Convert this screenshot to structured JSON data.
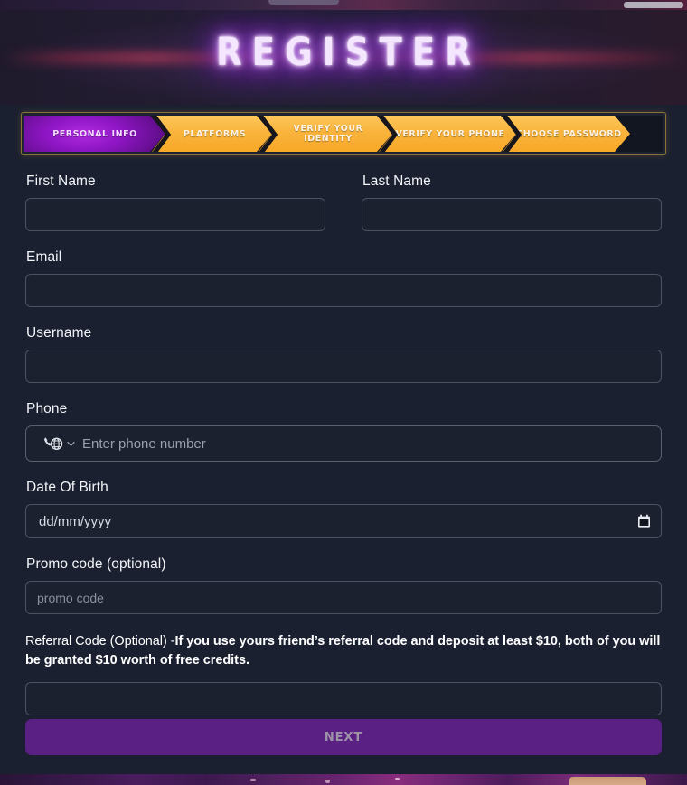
{
  "header": {
    "title": "REGISTER"
  },
  "steps": [
    {
      "label": "PERSONAL INFO",
      "state": "active"
    },
    {
      "label": "PLATFORMS",
      "state": "upcoming"
    },
    {
      "label": "VERIFY YOUR IDENTITY",
      "state": "upcoming"
    },
    {
      "label": "VERIFY YOUR PHONE",
      "state": "upcoming"
    },
    {
      "label": "CHOOSE PASSWORD",
      "state": "upcoming"
    }
  ],
  "form": {
    "first_name": {
      "label": "First Name",
      "value": "",
      "placeholder": ""
    },
    "last_name": {
      "label": "Last Name",
      "value": "",
      "placeholder": ""
    },
    "email": {
      "label": "Email",
      "value": "",
      "placeholder": ""
    },
    "username": {
      "label": "Username",
      "value": "",
      "placeholder": ""
    },
    "phone": {
      "label": "Phone",
      "value": "",
      "placeholder": "Enter phone number",
      "country_selector_icon": "phone-globe-icon"
    },
    "dob": {
      "label": "Date Of Birth",
      "value": "",
      "placeholder": "dd/mm/yyyy",
      "picker_icon": "calendar-icon"
    },
    "promo": {
      "label": "Promo code (optional)",
      "value": "",
      "placeholder": "promo code"
    },
    "referral": {
      "label_regular": "Referral Code (Optional) -",
      "label_bold": "If you use yours friend’s referral code and deposit at least $10, both of you will be granted $10 worth of free credits.",
      "value": "",
      "placeholder": ""
    },
    "submit": {
      "label": "NEXT"
    }
  },
  "colors": {
    "page_background": "#1b2030",
    "field_background": "#1c2130",
    "field_border": "#4b5261",
    "step_upcoming": "#f9b43c",
    "step_active": "#8e16c4",
    "step_bar_border": "#8a7333",
    "next_button": "#5b2084",
    "next_button_text": "#9d93a6",
    "title_glow": "#9b3fe0",
    "text_primary": "#f2f4f8"
  }
}
